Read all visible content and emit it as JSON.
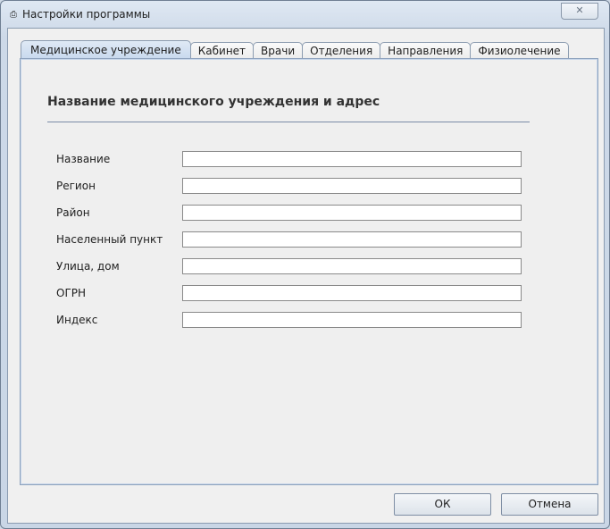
{
  "window": {
    "title": "Настройки программы",
    "close_label": "✕"
  },
  "tabs": [
    "Медицинское учреждение",
    "Кабинет",
    "Врачи",
    "Отделения",
    "Направления",
    "Физиолечение"
  ],
  "section_title": "Название медицинского учреждения и адрес",
  "fields": [
    {
      "label": "Название",
      "value": ""
    },
    {
      "label": "Регион",
      "value": ""
    },
    {
      "label": "Район",
      "value": ""
    },
    {
      "label": "Населенный пункт",
      "value": ""
    },
    {
      "label": "Улица, дом",
      "value": ""
    },
    {
      "label": "ОГРН",
      "value": ""
    },
    {
      "label": "Индекс",
      "value": ""
    }
  ],
  "buttons": {
    "ok": "ОК",
    "cancel": "Отмена"
  }
}
